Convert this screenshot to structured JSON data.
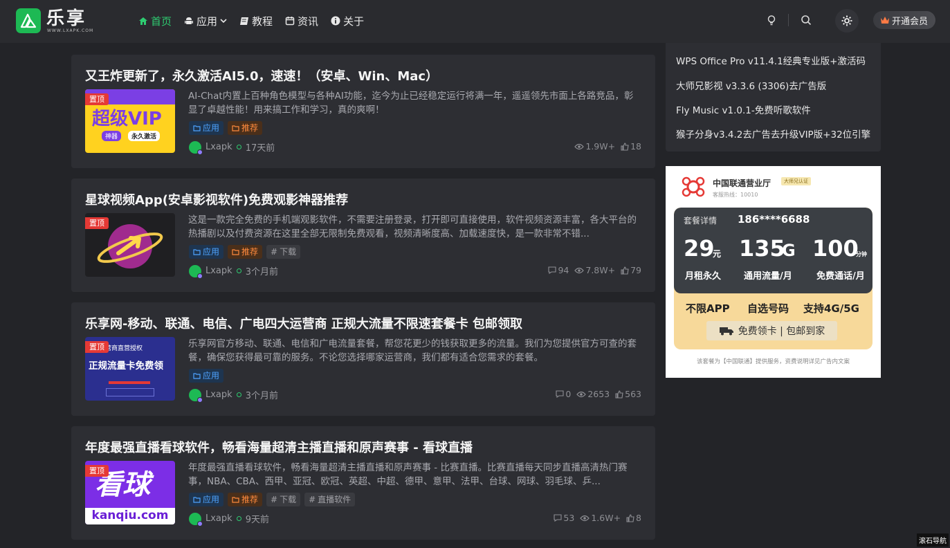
{
  "brand": {
    "name": "乐享",
    "domain": "WWW.LXAPK.COM"
  },
  "nav": [
    {
      "label": "首页",
      "active": true,
      "icon": "home-icon"
    },
    {
      "label": "应用",
      "icon": "android-icon",
      "dropdown": true
    },
    {
      "label": "教程",
      "icon": "book-icon"
    },
    {
      "label": "资讯",
      "icon": "calendar-icon"
    },
    {
      "label": "关于",
      "icon": "info-icon"
    }
  ],
  "header": {
    "vip_label": "开通会员"
  },
  "posts": [
    {
      "title": "又王炸更新了，永久激活AI5.0，速速！（安卓、Win、Mac）",
      "pin": "置顶",
      "thumb_text": "超级VIP",
      "thumb_sub1": "神器",
      "thumb_sub2": "永久激活",
      "excerpt": "AI-Chat内置上百种角色模型与各种AI功能，迄今为止已经稳定运行将满一年，遥遥领先市面上各路竞品，彰显了卓越性能！用来搞工作和学习，真的爽啊！",
      "tags": [
        {
          "label": "应用",
          "kind": "app"
        },
        {
          "label": "推荐",
          "kind": "rec"
        }
      ],
      "author": "Lxapk",
      "time": "17天前",
      "views": "1.9W+",
      "likes": "18"
    },
    {
      "title": "星球视频App(安卓影视软件)免费观影神器推荐",
      "pin": "置顶",
      "excerpt": "这是一款完全免费的手机端观影软件，不需要注册登录，打开即可直接使用，软件视频资源丰富，各大平台的热播剧以及付费资源在这里全部无限制免费观看，视频清晰度高、加载速度快，是一款非常不错...",
      "tags": [
        {
          "label": "应用",
          "kind": "app"
        },
        {
          "label": "推荐",
          "kind": "rec"
        },
        {
          "label": "下载",
          "kind": "gray"
        }
      ],
      "author": "Lxapk",
      "time": "3个月前",
      "comments": "94",
      "views": "7.8W+",
      "likes": "79"
    },
    {
      "title": "乐享网-移动、联通、电信、广电四大运营商 正规大流量不限速套餐卡 包邮领取",
      "pin": "置顶",
      "thumb_text": "正规流量卡免费领",
      "thumb_sub1": "运营商直营授权",
      "excerpt": "乐享网官方移动、联通、电信和广电流量套餐，帮您花更少的钱获取更多的流量。我们为您提供官方可查的套餐，确保您获得最可靠的服务。不论您选择哪家运营商，我们都有适合您需求的套餐。",
      "tags": [
        {
          "label": "应用",
          "kind": "app"
        }
      ],
      "author": "Lxapk",
      "time": "3个月前",
      "comments": "0",
      "views": "2653",
      "likes": "563"
    },
    {
      "title": "年度最强直播看球软件，畅看海量超清主播直播和原声赛事 - 看球直播",
      "pin": "置顶",
      "thumb_text": "看球",
      "thumb_sub1": "kanqiu.com",
      "excerpt": "年度最强直播看球软件，畅看海量超清主播直播和原声赛事 - 比赛直播。比赛直播每天同步直播高清热门赛事，NBA、CBA、西甲、亚冠、欧冠、英超、中超、德甲、意甲、法甲、台球、网球、羽毛球、乒...",
      "tags": [
        {
          "label": "应用",
          "kind": "app"
        },
        {
          "label": "推荐",
          "kind": "rec"
        },
        {
          "label": "下载",
          "kind": "gray"
        },
        {
          "label": "直播软件",
          "kind": "gray"
        }
      ],
      "author": "Lxapk",
      "time": "9天前",
      "comments": "53",
      "views": "1.6W+",
      "likes": "8"
    }
  ],
  "sidebar": {
    "items": [
      "WPS Office Pro v11.4.1经典专业版+激活码",
      "大师兄影视 v3.3.6 (3306)去广告版",
      "Fly Music v1.0.1-免费听歌软件",
      "猴子分身v3.4.2去广告去升级VIP版+32位引擎"
    ]
  },
  "ad": {
    "title": "中国联通营业厅",
    "vbadge": "大师兄认证",
    "hotline": "客服热线：10010",
    "detail_label": "套餐详情",
    "phone": "186****6688",
    "price": "29",
    "price_unit": "元",
    "data": "135",
    "data_unit": "G",
    "minutes": "100",
    "minutes_unit": "分钟",
    "price_label": "月租永久",
    "data_label": "通用流量/月",
    "minutes_label": "免费通话/月",
    "feat1": "不限APP",
    "feat2": "自选号码",
    "feat3": "支持4G/5G",
    "cta": "免费领卡 | 包邮到家",
    "footer": "该套餐为【中国联通】提供服务，资费说明详见广告内文案"
  },
  "corner_label": "滚石导航"
}
